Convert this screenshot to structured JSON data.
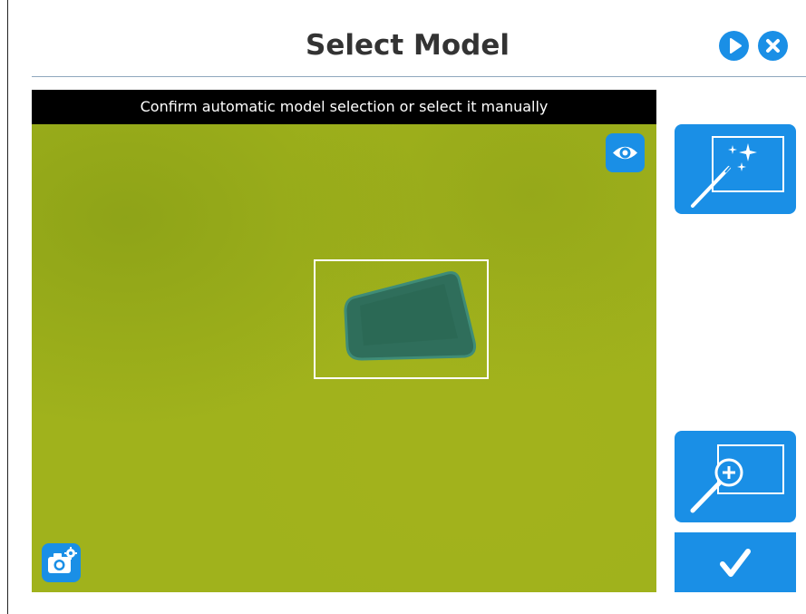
{
  "header": {
    "title": "Select Model"
  },
  "camera_view": {
    "banner_text": "Confirm automatic model selection or select it manually"
  },
  "icons": {
    "next": "play-icon",
    "close": "close-icon",
    "preview": "eye-icon",
    "camera_settings": "camera-settings-icon",
    "auto_select": "magic-wand-icon",
    "manual_select": "zoom-select-icon",
    "confirm": "checkmark-icon"
  },
  "colors": {
    "accent": "#1a8fe6",
    "banner_bg": "#000000",
    "camera_bg": "#a0b21c",
    "part": "#2e6b57"
  }
}
